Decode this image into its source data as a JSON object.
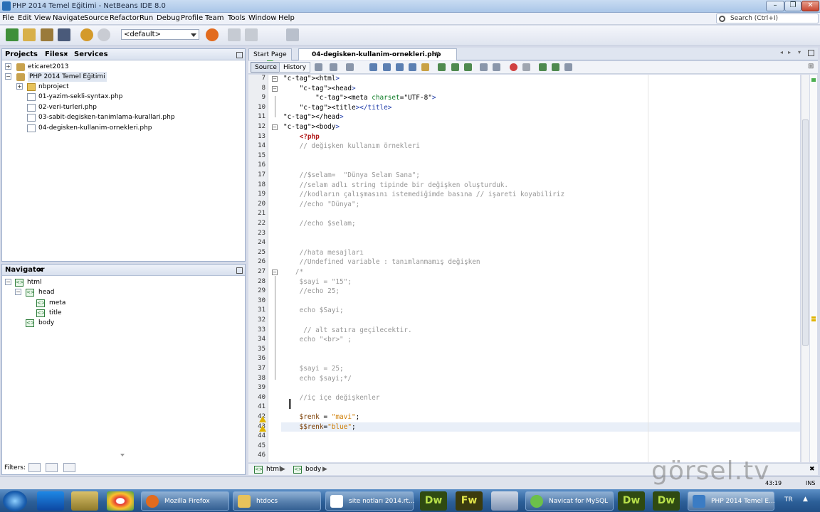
{
  "window": {
    "title": "PHP 2014 Temel Eğitimi - NetBeans IDE 8.0"
  },
  "menu": [
    "File",
    "Edit",
    "View",
    "Navigate",
    "Source",
    "Refactor",
    "Run",
    "Debug",
    "Profile",
    "Team",
    "Tools",
    "Window",
    "Help"
  ],
  "search": {
    "placeholder": "Search (Ctrl+I)"
  },
  "toolbar": {
    "config_value": "<default>"
  },
  "projects_panel": {
    "tabs": [
      "Projects",
      "Files",
      "Services"
    ],
    "tree": [
      {
        "label": "eticaret2013",
        "level": 0,
        "icon": "project-icon"
      },
      {
        "label": "PHP 2014 Temel Eğitimi",
        "level": 0,
        "icon": "project-icon"
      },
      {
        "label": "nbproject",
        "level": 1,
        "icon": "folder-icon"
      },
      {
        "label": "01-yazim-sekli-syntax.php",
        "level": 1,
        "icon": "php-file-icon"
      },
      {
        "label": "02-veri-turleri.php",
        "level": 1,
        "icon": "php-file-icon"
      },
      {
        "label": "03-sabit-degisken-tanimlama-kurallari.php",
        "level": 1,
        "icon": "php-file-icon"
      },
      {
        "label": "04-degisken-kullanim-ornekleri.php",
        "level": 1,
        "icon": "php-file-icon"
      }
    ]
  },
  "navigator_panel": {
    "title": "Navigator",
    "tree": [
      {
        "label": "html",
        "level": 0
      },
      {
        "label": "head",
        "level": 1
      },
      {
        "label": "meta",
        "level": 2
      },
      {
        "label": "title",
        "level": 2
      },
      {
        "label": "body",
        "level": 1
      }
    ],
    "filters_label": "Filters:"
  },
  "editor": {
    "tabs": [
      "Start Page",
      "04-degisken-kullanim-ornekleri.php"
    ],
    "views": [
      "Source",
      "History"
    ],
    "lines": [
      {
        "n": "7",
        "t": "<html>"
      },
      {
        "n": "8",
        "t": "    <head>"
      },
      {
        "n": "9",
        "t": "        <meta charset=\"UTF-8\">"
      },
      {
        "n": "10",
        "t": "    <title></title>"
      },
      {
        "n": "11",
        "t": "</head>"
      },
      {
        "n": "12",
        "t": "<body>"
      },
      {
        "n": "13",
        "t": "    <?php"
      },
      {
        "n": "14",
        "t": "    // değişken kullanım örnekleri"
      },
      {
        "n": "15",
        "t": ""
      },
      {
        "n": "16",
        "t": ""
      },
      {
        "n": "17",
        "t": "    //$selam=  \"Dünya Selam Sana\";"
      },
      {
        "n": "18",
        "t": "    //selam adlı string tipinde bir değişken oluşturduk."
      },
      {
        "n": "19",
        "t": "    //kodların çalışmasını istemediğimde basına // işareti koyabiliriz"
      },
      {
        "n": "20",
        "t": "    //echo \"Dünya\";"
      },
      {
        "n": "21",
        "t": ""
      },
      {
        "n": "22",
        "t": "    //echo $selam;"
      },
      {
        "n": "23",
        "t": ""
      },
      {
        "n": "24",
        "t": ""
      },
      {
        "n": "25",
        "t": "    //hata mesajları"
      },
      {
        "n": "26",
        "t": "    //Undefined variable : tanımlanmamış değişken"
      },
      {
        "n": "27",
        "t": "   /*"
      },
      {
        "n": "28",
        "t": "    $sayi = \"15\";"
      },
      {
        "n": "29",
        "t": "    //echo 25;"
      },
      {
        "n": "30",
        "t": ""
      },
      {
        "n": "31",
        "t": "    echo $Sayi;"
      },
      {
        "n": "32",
        "t": ""
      },
      {
        "n": "33",
        "t": "     // alt satıra geçilecektir."
      },
      {
        "n": "34",
        "t": "    echo \"<br>\" ;"
      },
      {
        "n": "35",
        "t": ""
      },
      {
        "n": "36",
        "t": ""
      },
      {
        "n": "37",
        "t": "    $sayi = 25;"
      },
      {
        "n": "38",
        "t": "    echo $sayi;*/"
      },
      {
        "n": "39",
        "t": ""
      },
      {
        "n": "40",
        "t": "    //iç içe değişkenler"
      },
      {
        "n": "41",
        "t": ""
      },
      {
        "n": "42",
        "t": "    $renk = \"mavi\";"
      },
      {
        "n": "43",
        "t": "    $$renk=\"blue\";"
      },
      {
        "n": "44",
        "t": ""
      },
      {
        "n": "45",
        "t": ""
      },
      {
        "n": "46",
        "t": ""
      }
    ],
    "breadcrumb": [
      "html",
      "body"
    ]
  },
  "status": {
    "position": "43:19",
    "mode": "INS"
  },
  "taskbar": {
    "items": [
      "Mozilla Firefox",
      "htdocs",
      "site notları 2014.rt...",
      "Navicat for MySQL",
      "PHP 2014 Temel E..."
    ],
    "pins": [
      "Dw",
      "Fw",
      "Dw",
      "Dw"
    ],
    "lang": "TR"
  },
  "watermark": "görsel.tv"
}
